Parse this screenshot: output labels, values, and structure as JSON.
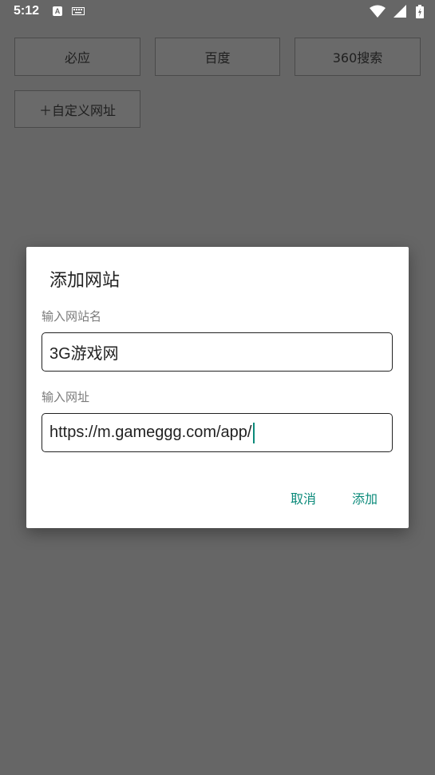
{
  "status_bar": {
    "time": "5:12",
    "notification_icon": "A"
  },
  "buttons": {
    "biying": "必应",
    "baidu": "百度",
    "so360": "360搜索",
    "custom": "＋自定义网址"
  },
  "dialog": {
    "title": "添加网站",
    "name_label": "输入网站名",
    "name_value": "3G游戏网",
    "url_label": "输入网址",
    "url_value": "https://m.gameggg.com/app/",
    "cancel": "取消",
    "add": "添加"
  },
  "colors": {
    "accent": "#0b8a7a",
    "scrim": "#666666"
  }
}
